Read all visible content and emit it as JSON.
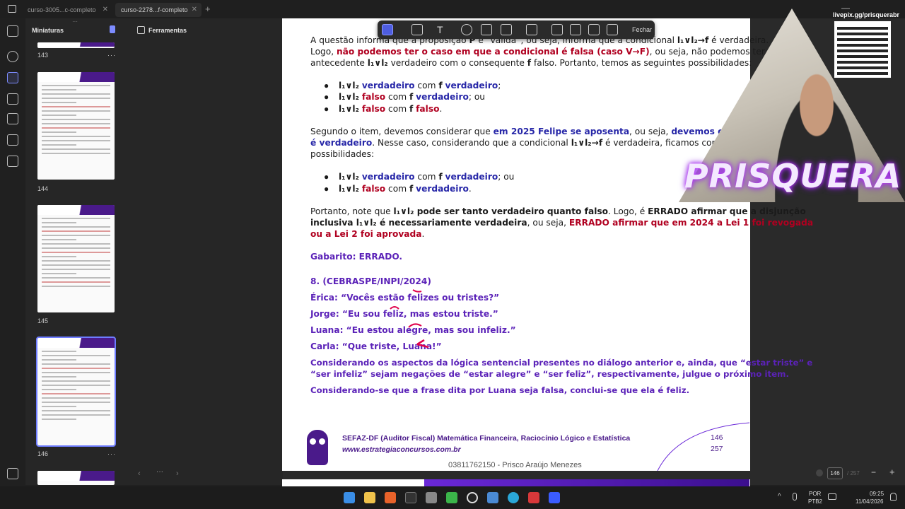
{
  "tabs": [
    {
      "label": "curso-3005...c-completo"
    },
    {
      "label": "curso-2278...f-completo"
    }
  ],
  "sidebar": {
    "title": "Miniaturas",
    "tools_title": "Ferramentas",
    "pages": [
      "143",
      "144",
      "145",
      "146"
    ]
  },
  "toolbar": {
    "close": "Fechar"
  },
  "doc": {
    "p1a": "A questão informa que a proposição ",
    "p1b": "P",
    "p1c": " é “válida”, ou seja, informa que a condicional ",
    "p1d": "l₁∨l₂→f",
    "p1e": " é verdadeira.",
    "p2a": "Logo, ",
    "p2b": "não podemos ter o caso em que a condicional é falsa (caso V→F)",
    "p2c": ", ou seja, não podemos ter o",
    "p3a": "antecedente ",
    "p3b": "l₁∨l₂",
    "p3c": " verdadeiro com o consequente ",
    "p3d": "f",
    "p3e": " falso. Portanto, temos as seguintes possibilidades:",
    "b1": [
      "l₁∨l₂",
      "verdadeiro",
      " com ",
      "f",
      "verdadeiro",
      ";"
    ],
    "b2": [
      "l₁∨l₂",
      "falso",
      " com ",
      "f",
      "verdadeiro",
      "; ou"
    ],
    "b3": [
      "l₁∨l₂",
      "falso",
      " com ",
      "f",
      "falso",
      "."
    ],
    "s1a": "Segundo o item, devemos considerar que ",
    "s1b": "em 2025 Felipe se aposenta",
    "s1c": ",  ou seja, ",
    "s1d": "devemos considerar que ",
    "s2a": "é verdadeiro",
    "s2b": ". Nesse caso, considerando que a condicional ",
    "s2c": "l₁∨l₂→f",
    "s2d": " é verdadeira, ficamos com as seguintes",
    "s3": "possibilidades:",
    "c1": [
      "l₁∨l₂",
      "verdadeiro",
      " com ",
      "f",
      "verdadeiro",
      "; ou"
    ],
    "c2": [
      "l₁∨l₂",
      "falso",
      " com ",
      "f",
      "verdadeiro",
      "."
    ],
    "t1a": "Portanto, note que ",
    "t1b": "l₁∨l₂",
    "t1c": " pode ser tanto verdadeiro quanto falso",
    "t1d": ". Logo, é ",
    "t1e": "ERRADO afirmar que a disjunção",
    "t2a": "inclusiva ",
    "t2b": "l₁∨l₂",
    "t2c": " é necessariamente verdadeira",
    "t2d": ", ou seja, ",
    "t2e": "ERRADO afirmar que em 2024 a Lei 1 foi revogada",
    "t3a": "ou a Lei 2 foi aprovada",
    "t3b": ".",
    "gab": "Gabarito: ERRADO.",
    "q": "8. (CEBRASPE/INPI/2024)",
    "d1": "Érica: “Vocês estão felizes ou tristes?”",
    "d2": "Jorge: “Eu sou feliz, mas estou triste.”",
    "d3": "Luana: “Eu estou alegre, mas sou infeliz.”",
    "d4": "Carla: “Que triste, Luana!”",
    "e1": "Considerando os aspectos da lógica sentencial presentes no diálogo anterior e, ainda, que “estar triste” e",
    "e2": "“ser infeliz” sejam negações de “estar alegre” e “ser feliz”, respectivamente, julgue o próximo item.",
    "e3": "Considerando-se que a frase dita por Luana seja falsa, conclui-se que ela é feliz.",
    "f1": "SEFAZ-DF (Auditor Fiscal) Matemática Financeira, Raciocínio Lógico e Estatística",
    "f2": "www.estrategiaconcursos.com.br",
    "fp1": "146",
    "fp2": "257",
    "owner": "03811762150 - Prisco Araújo Menezes"
  },
  "overlay": {
    "url": "livepix.gg/prisquerabr",
    "brand": "PRISQUERA"
  },
  "pager": {
    "page": "146",
    "total": "/ 257"
  },
  "tray": {
    "lang1": "POR",
    "lang2": "PTB2",
    "time": "09:25",
    "date": "11/04/2026"
  }
}
